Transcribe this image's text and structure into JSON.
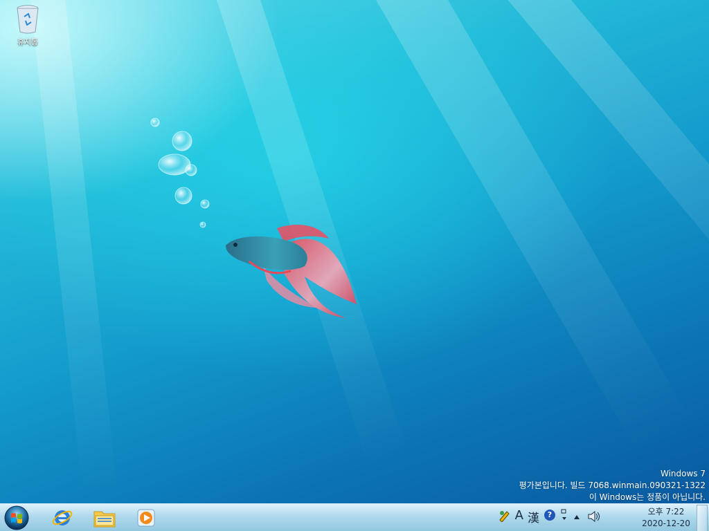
{
  "desktop": {
    "recycle_bin_label": "휴지통",
    "watermark": {
      "line1": "Windows 7",
      "line2": "평가본입니다. 빌드 7068.winmain.090321-1322",
      "line3": "이 Windows는 정품이 아닙니다."
    }
  },
  "taskbar": {
    "apps": [
      {
        "name": "internet-explorer"
      },
      {
        "name": "windows-explorer"
      },
      {
        "name": "windows-media-player"
      }
    ],
    "tray": {
      "ime_mode_label": "A",
      "hanja_label": "漢",
      "help_label": "?",
      "volume_icon": "speaker-icon"
    },
    "clock": {
      "time": "오후 7:22",
      "date": "2020-12-20"
    }
  },
  "colors": {
    "accent": "#139bcc",
    "taskbar": "#aad7eb"
  }
}
